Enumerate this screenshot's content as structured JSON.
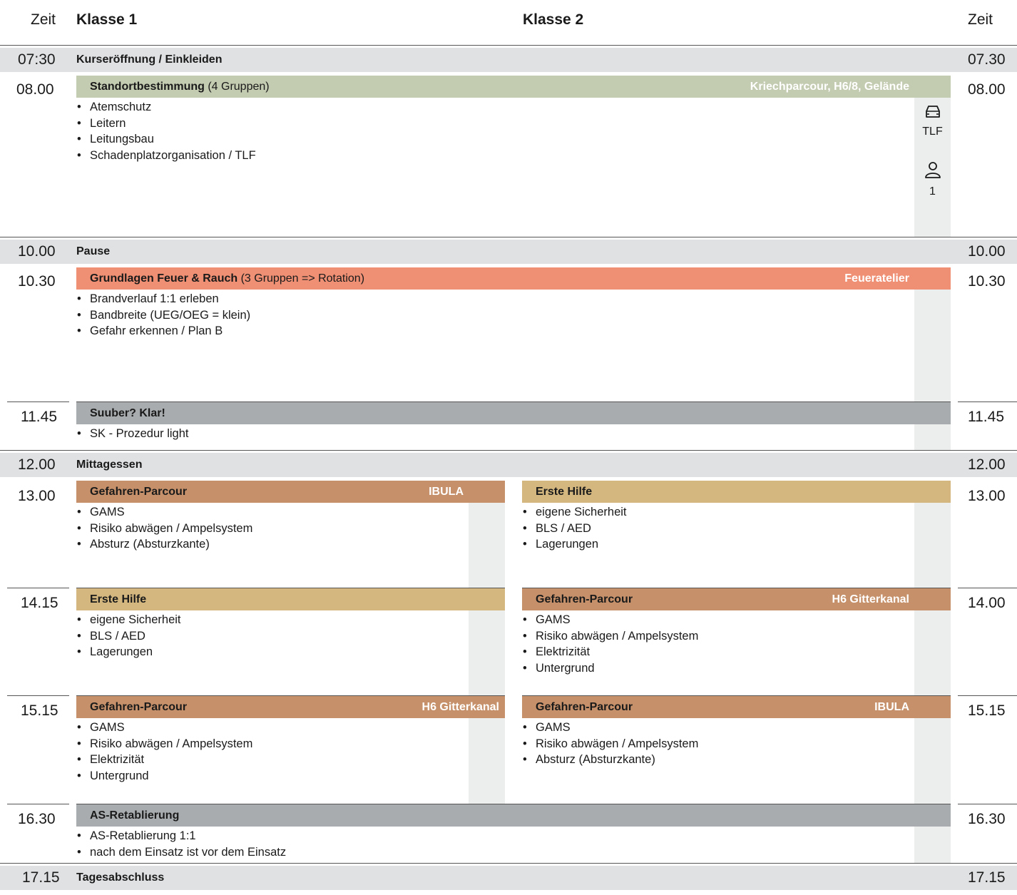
{
  "header": {
    "zeit_left": "Zeit",
    "klasse1": "Klasse 1",
    "klasse2": "Klasse 2",
    "zeit_right": "Zeit"
  },
  "bands": [
    {
      "time_left": "07:30",
      "title": "Kurseröffnung / Einkleiden",
      "time_right": "07.30"
    },
    {
      "time_left": "10.00",
      "title": "Pause",
      "time_right": "10.00"
    },
    {
      "time_left": "12.00",
      "title": "Mittagessen",
      "time_right": "12.00"
    },
    {
      "time_left": "17.15",
      "title": "Tagesabschluss",
      "time_right": "17.15"
    }
  ],
  "blocks": {
    "standort": {
      "time_left": "08.00",
      "time_right": "08.00",
      "title": "Standortbestimmung",
      "suffix": " (4 Gruppen)",
      "location": "Kriechparcour, H6/8, Gelände",
      "items": [
        "Atemschutz",
        "Leitern",
        "Leitungsbau",
        "Schadenplatzorganisation / TLF"
      ],
      "vehicle_icon": "car-icon",
      "vehicle_label": "TLF",
      "person_icon": "person-icon",
      "person_count": "1"
    },
    "feuer": {
      "time_left": "10.30",
      "time_right": "10.30",
      "title": "Grundlagen Feuer & Rauch",
      "suffix": " (3 Gruppen => Rotation)",
      "location": "Feueratelier",
      "items": [
        "Brandverlauf 1:1 erleben",
        "Bandbreite (UEG/OEG = klein)",
        "Gefahr erkennen / Plan B"
      ]
    },
    "suuber": {
      "time_left": "11.45",
      "time_right": "11.45",
      "title": "Suuber? Klar!",
      "items": [
        "SK - Prozedur light"
      ]
    },
    "k1_1300": {
      "time": "13.00",
      "title": "Gefahren-Parcour",
      "location": "IBULA",
      "items": [
        "GAMS",
        "Risiko abwägen / Ampelsystem",
        "Absturz (Absturzkante)"
      ]
    },
    "k2_1300": {
      "time": "13.00",
      "title": "Erste Hilfe",
      "items": [
        "eigene Sicherheit",
        "BLS / AED",
        "Lagerungen"
      ]
    },
    "k1_1415": {
      "time": "14.15",
      "title": "Erste Hilfe",
      "items": [
        "eigene Sicherheit",
        "BLS / AED",
        "Lagerungen"
      ]
    },
    "k2_1400": {
      "time": "14.00",
      "title": "Gefahren-Parcour",
      "location": "H6 Gitterkanal",
      "items": [
        "GAMS",
        "Risiko abwägen / Ampelsystem",
        "Elektrizität",
        "Untergrund"
      ]
    },
    "k1_1515": {
      "time": "15.15",
      "title": "Gefahren-Parcour",
      "location": "H6 Gitterkanal",
      "items": [
        "GAMS",
        "Risiko abwägen / Ampelsystem",
        "Elektrizität",
        "Untergrund"
      ]
    },
    "k2_1515": {
      "time": "15.15",
      "title": "Gefahren-Parcour",
      "location": "IBULA",
      "items": [
        "GAMS",
        "Risiko abwägen / Ampelsystem",
        "Absturz (Absturzkante)"
      ]
    },
    "as": {
      "time_left": "16.30",
      "time_right": "16.30",
      "title": "AS-Retablierung",
      "items": [
        "AS-Retablierung 1:1",
        "nach dem Einsatz ist vor dem Einsatz"
      ]
    }
  },
  "colors": {
    "band": "#dfe1e3",
    "standort": "#c3cbb1",
    "feuer": "#ef8f73",
    "cleanup": "#a9acae",
    "gefahren": "#c6916a",
    "erste_hilfe": "#d3b77f"
  }
}
